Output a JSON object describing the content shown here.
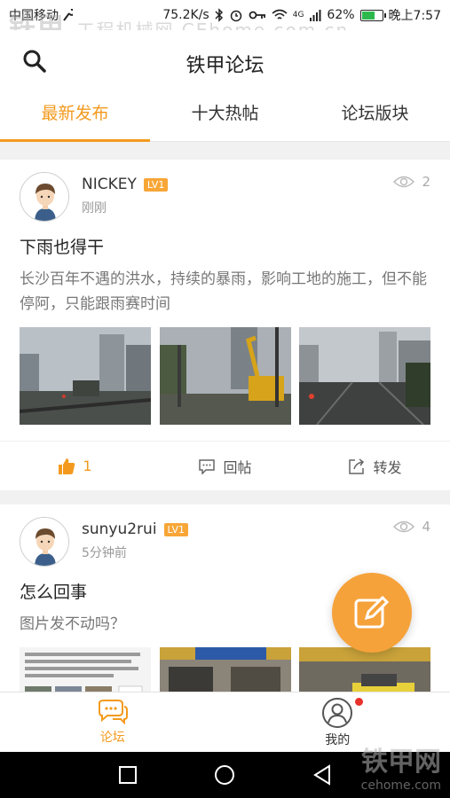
{
  "status_bar": {
    "carrier": "中国移动",
    "speed": "75.2K/s",
    "network": "4G",
    "battery": "62%",
    "battery_level": 0.62,
    "time": "晚上7:57"
  },
  "watermark": {
    "top_left": "铁甲",
    "top_left_sub": "工程机械网 CEhome.com.cn",
    "bottom_right": "铁甲网",
    "bottom_right_sub": "cehome.com"
  },
  "header": {
    "title": "铁甲论坛"
  },
  "tabs": [
    {
      "label": "最新发布",
      "active": true
    },
    {
      "label": "十大热帖",
      "active": false
    },
    {
      "label": "论坛版块",
      "active": false
    }
  ],
  "posts": [
    {
      "username": "NICKEY",
      "level": "LV1",
      "time": "刚刚",
      "views": "2",
      "title": "下雨也得干",
      "body": "长沙百年不遇的洪水，持续的暴雨，影响工地的施工，但不能停阿，只能跟雨赛时间",
      "likes": "1",
      "reply_label": "回帖",
      "share_label": "转发"
    },
    {
      "username": "sunyu2rui",
      "level": "LV1",
      "time": "5分钟前",
      "views": "4",
      "title": "怎么回事",
      "body": "图片发不动吗？"
    }
  ],
  "bottom_nav": [
    {
      "label": "论坛",
      "active": true
    },
    {
      "label": "我的",
      "active": false
    }
  ],
  "colors": {
    "accent": "#f39a1e",
    "fab": "#f6a23a",
    "badge_red": "#e8322b"
  }
}
